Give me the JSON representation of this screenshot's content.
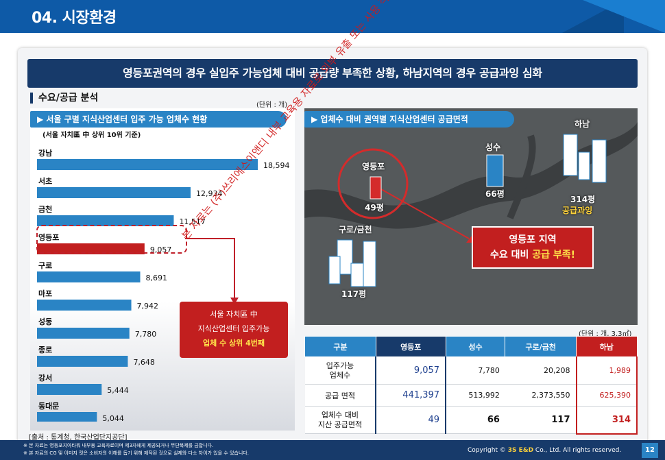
{
  "header": {
    "title": "04. 시장환경"
  },
  "banner": "영등포권역의 경우 실입주 가능업체 대비 공급량 부족한 상황, 하남지역의 경우 공급과잉 심화",
  "section": {
    "title": "수요/공급 분석",
    "unit": "(단위 : 개)"
  },
  "left": {
    "heading": "▶ 서울 구별 지식산업센터 입주 가능 업체수 현황",
    "subheading": "(서울 자치區 中 상위 10위 기준)",
    "source": "[출처 : 통계청, 한국산업단지공단]"
  },
  "chart_data": {
    "type": "bar",
    "orientation": "horizontal",
    "categories": [
      "강남",
      "서초",
      "금천",
      "영등포",
      "구로",
      "마포",
      "성동",
      "종로",
      "강서",
      "동대문"
    ],
    "values": [
      18594,
      12934,
      11517,
      9057,
      8691,
      7942,
      7780,
      7648,
      5444,
      5044
    ],
    "labels": [
      "18,594",
      "12,934",
      "11,517",
      "9,057",
      "8,691",
      "7,942",
      "7,780",
      "7,648",
      "5,444",
      "5,044"
    ],
    "highlight": "영등포",
    "bar_color": "#2a84c5",
    "highlight_color": "#c21f1f"
  },
  "callout": {
    "line1": "서울 자치區 中",
    "line2": "지식산업센터 입주가능",
    "line3": "업체 수 상위 4번째"
  },
  "right": {
    "heading": "▶ 업체수 대비 권역별 지식산업센터 공급면적",
    "map_labels": {
      "ydp": "영등포",
      "ydp_val": "49평",
      "ss": "성수",
      "ss_val": "66평",
      "hn": "하남",
      "hn_val": "314평",
      "hn_note": "공급과잉",
      "gr": "구로/금천",
      "gr_val": "117평"
    },
    "map_callout": {
      "line1": "영등포 지역",
      "line2a": "수요 대비 ",
      "line2b": "공급 부족!"
    },
    "unit": "(단위 : 개, 3.3㎡)"
  },
  "table": {
    "headers": [
      "구분",
      "영등포",
      "성수",
      "구로/금천",
      "하남"
    ],
    "rows": [
      {
        "label": "입주가능\n업체수",
        "values": [
          "9,057",
          "7,780",
          "20,208",
          "1,989"
        ]
      },
      {
        "label": "공급 면적",
        "values": [
          "441,397",
          "513,992",
          "2,373,550",
          "625,390"
        ]
      },
      {
        "label": "업체수 대비\n지산 공급면적",
        "values": [
          "49",
          "66",
          "117",
          "314"
        ]
      }
    ]
  },
  "footer": {
    "note1": "※ 본 자료는 영등포지아타워 내부용 교육자료이며 제3자에게 제공되거나 무단복제를 금합니다.",
    "note2": "※ 본 자료의 CG 및 이미지 컷은 소비자의 이해를 돕기 위해 제작된 것으로 실제와 다소 차이가 있을 수 있습니다.",
    "copyright_pre": "Copyright © ",
    "copyright_brand": "3S E&D",
    "copyright_post": " Co., Ltd. All rights reserved.",
    "page": "12"
  },
  "watermark": "본 자료는 (주)쓰리에스이앤디 내부 교육용 자료로 외부 유출 또는 사용 적발 시 고발 조치될 수 있습니다."
}
